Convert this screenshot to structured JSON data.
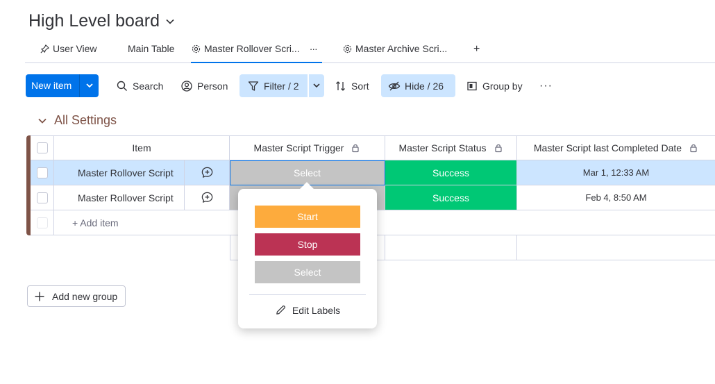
{
  "board": {
    "title": "High Level board"
  },
  "tabs": [
    {
      "label": "User View",
      "icon": "pin-icon"
    },
    {
      "label": "Main Table",
      "icon": ""
    },
    {
      "label": "Master Rollover Scri...",
      "icon": "gear-icon",
      "more": "···"
    },
    {
      "label": "Master Archive Scri...",
      "icon": "gear-icon"
    }
  ],
  "tab_add": "+",
  "toolbar": {
    "new_item": "New item",
    "search": "Search",
    "person": "Person",
    "filter": "Filter / 2",
    "sort": "Sort",
    "hide": "Hide / 26",
    "group_by": "Group by",
    "more": "···"
  },
  "group": {
    "title": "All Settings",
    "color": "#7e5347",
    "columns": {
      "item": "Item",
      "trigger": "Master Script Trigger",
      "status": "Master Script Status",
      "date": "Master Script last Completed Date"
    },
    "rows": [
      {
        "name": "Master Rollover Script",
        "trigger": "Select",
        "status": "Success",
        "date": "Mar 1, 12:33 AM",
        "selected": true
      },
      {
        "name": "Master Rollover Script",
        "trigger": "",
        "status": "Success",
        "date": "Feb 4, 8:50 AM",
        "selected": false
      }
    ],
    "add_item": "+ Add item"
  },
  "add_group": "Add new group",
  "status_popover": {
    "options": [
      {
        "label": "Start",
        "color": "#fdab3d"
      },
      {
        "label": "Stop",
        "color": "#bb3354"
      },
      {
        "label": "Select",
        "color": "#c4c4c4"
      }
    ],
    "edit_labels": "Edit Labels"
  },
  "colors": {
    "accent": "#0073ea",
    "success": "#00c875",
    "row_selected": "#cce5ff",
    "select_gray": "#c4c4c4"
  }
}
